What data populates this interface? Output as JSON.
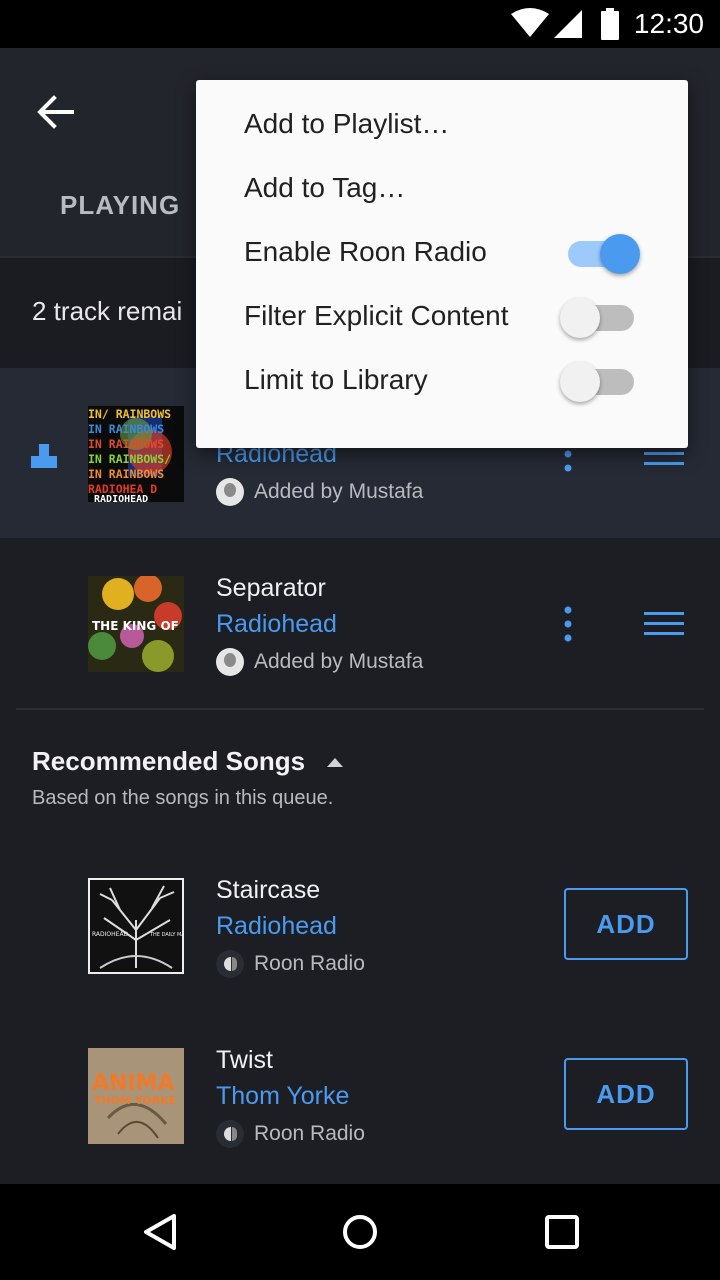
{
  "status_bar": {
    "time": "12:30"
  },
  "header": {
    "tab_playing": "PLAYING"
  },
  "queue": {
    "remaining_text": "2 track remai",
    "tracks": [
      {
        "title": "",
        "artist": "Radiohead",
        "added_by": "Added by Mustafa",
        "album_art": "in-rainbows"
      },
      {
        "title": "Separator",
        "artist": "Radiohead",
        "added_by": "Added by Mustafa",
        "album_art": "the-king-of-limbs"
      }
    ]
  },
  "recommended": {
    "title": "Recommended Songs",
    "subtitle": "Based on the songs in this queue.",
    "items": [
      {
        "title": "Staircase",
        "artist": "Radiohead",
        "source": "Roon Radio",
        "action": "ADD"
      },
      {
        "title": "Twist",
        "artist": "Thom Yorke",
        "source": "Roon Radio",
        "action": "ADD"
      }
    ]
  },
  "menu": {
    "items": [
      {
        "label": "Add to Playlist…"
      },
      {
        "label": "Add to Tag…"
      },
      {
        "label": "Enable Roon Radio",
        "toggle": true
      },
      {
        "label": "Filter Explicit Content",
        "toggle": false
      },
      {
        "label": "Limit to Library",
        "toggle": false
      }
    ]
  },
  "colors": {
    "accent": "#4a9bf0",
    "background": "#1c1e24",
    "current_row": "#252a34",
    "menu_bg": "#fafafa"
  }
}
